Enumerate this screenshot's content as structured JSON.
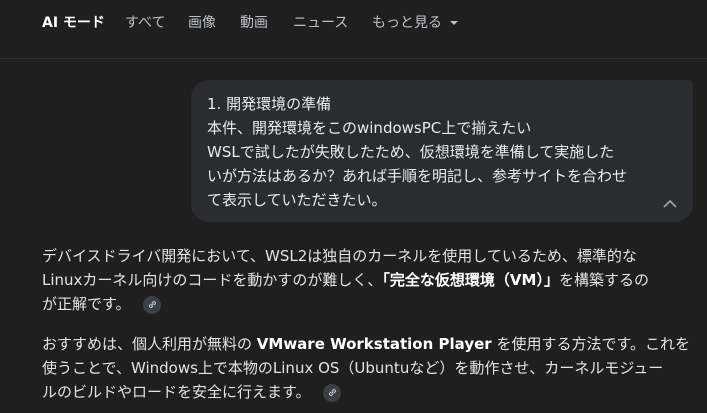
{
  "nav": {
    "items": [
      "AI モード",
      "すべて",
      "画像",
      "動画",
      "ニュース"
    ],
    "more_label": "もっと見る"
  },
  "user_message": {
    "lines": [
      "1. 開発環境の準備",
      "本件、開発環境をこのwindowsPC上で揃えたい",
      "WSLで試したが失敗したため、仮想環境を準備して実施した",
      "いが方法はあるか？あれば手順を明記し、参考サイトを合わせ",
      "て表示していただきたい。"
    ]
  },
  "answer": {
    "p1": {
      "line1": "デバイスドライバ開発において、WSL2は独自のカーネルを使用しているため、標準的な",
      "line2_pre": "Linuxカーネル向けのコードを動かすのが難しく、",
      "line2_bold": "「完全な仮想環境（VM）」",
      "line2_post": "を構築するの",
      "line3": "が正解です。"
    },
    "p2": {
      "line1_pre": "おすすめは、個人利用が無料の ",
      "line1_bold": "VMware Workstation Player",
      "line1_post": " を使用する方法です。これを",
      "line2": "使うことで、Windows上で本物のLinux OS（Ubuntuなど）を動作させ、カーネルモジュー",
      "line3": "ルのビルドやロードを安全に行えます。"
    }
  }
}
